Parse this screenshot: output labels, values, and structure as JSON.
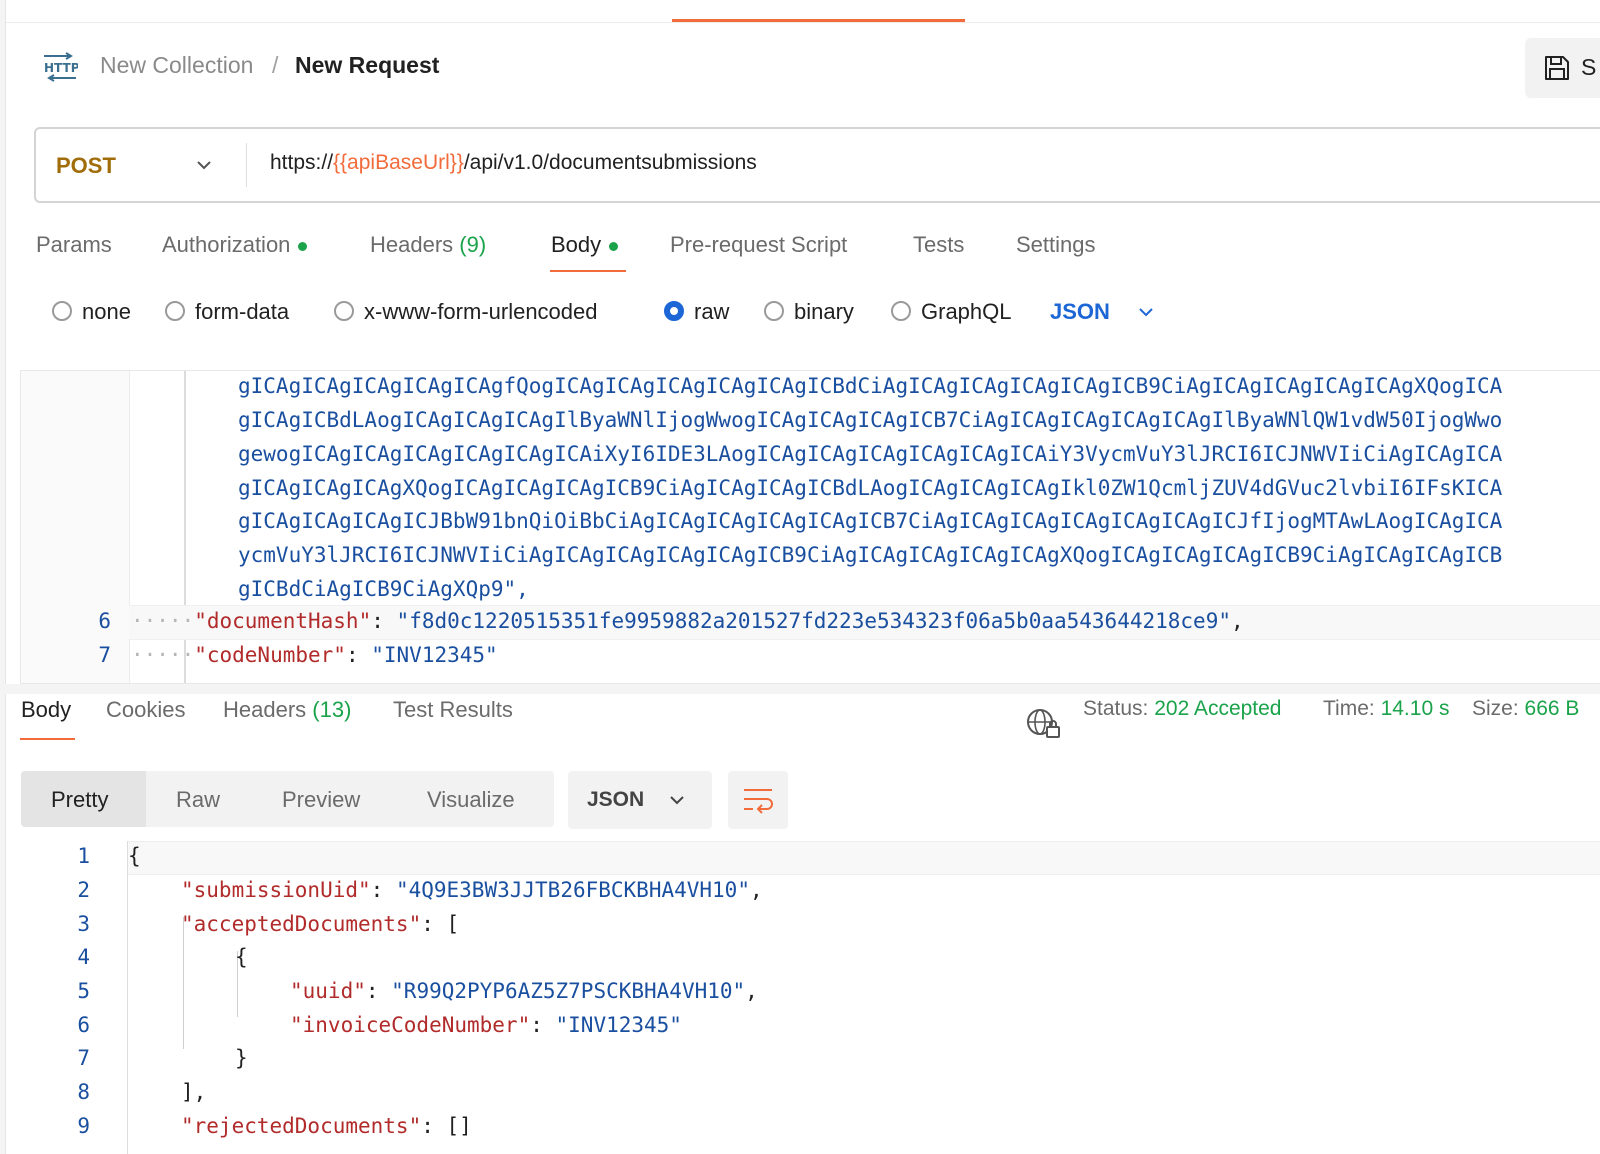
{
  "breadcrumb": {
    "collection": "New Collection",
    "separator": "/",
    "request": "New Request"
  },
  "save_button": {
    "label": "S"
  },
  "request": {
    "method": "POST",
    "url_prefix": "https://",
    "url_variable": "{{apiBaseUrl}}",
    "url_suffix": "/api/v1.0/documentsubmissions"
  },
  "request_tabs": [
    {
      "label": "Params"
    },
    {
      "label": "Authorization",
      "dot": true
    },
    {
      "label": "Headers",
      "count": "(9)"
    },
    {
      "label": "Body",
      "dot": true,
      "active": true
    },
    {
      "label": "Pre-request Script"
    },
    {
      "label": "Tests"
    },
    {
      "label": "Settings"
    }
  ],
  "body_types": [
    "none",
    "form-data",
    "x-www-form-urlencoded",
    "raw",
    "binary",
    "GraphQL"
  ],
  "body_type_selected": "raw",
  "body_format": "JSON",
  "request_editor": {
    "wrapped_lines": [
      "gICAgICAgICAgICAgICAgfQogICAgICAgICAgICAgICAgICBdCiAgICAgICAgICAgICAgICB9CiAgICAgICAgICAgICAgXQogICA",
      "gICAgICBdLAogICAgICAgICAgIlByaWNlIjogWwogICAgICAgICAgICB7CiAgICAgICAgICAgICAgIlByaWNlQW1vdW50IjogWwo",
      "gewogICAgICAgICAgICAgICAgICAiXyI6IDE3LAogICAgICAgICAgICAgICAgICAiY3VycmVuY3lJRCI6ICJNWVIiCiAgICAgICA",
      "gICAgICAgICAgXQogICAgICAgICAgICB9CiAgICAgICAgICBdLAogICAgICAgICAgIkl0ZW1QcmljZUV4dGVuc2lvbiI6IFsKICA",
      "gICAgICAgICAgICJBbW91bnQiOiBbCiAgICAgICAgICAgICAgICB7CiAgICAgICAgICAgICAgICAgICJfIjogMTAwLAogICAgICA",
      "ycmVuY3lJRCI6ICJNWVIiCiAgICAgICAgICAgICAgICB9CiAgICAgICAgICAgICAgXQogICAgICAgICAgICB9CiAgICAgICAgICB",
      "gICBdCiAgICB9CiAgXQp9\","
    ],
    "line6": {
      "number": "6",
      "dots": "·····",
      "key": "\"documentHash\"",
      "sep": ":",
      "value": "\"f8d0c1220515351fe9959882a201527fd223e534323f06a5b0aa543644218ce9\"",
      "comma": ","
    },
    "line7": {
      "number": "7",
      "dots": "·····",
      "key": "\"codeNumber\"",
      "sep": ":",
      "value": "\"INV12345\""
    }
  },
  "response_tabs": [
    {
      "label": "Body",
      "active": true
    },
    {
      "label": "Cookies"
    },
    {
      "label": "Headers",
      "count": "(13)"
    },
    {
      "label": "Test Results"
    }
  ],
  "response_status": {
    "status_label": "Status:",
    "status_value": "202 Accepted",
    "time_label": "Time:",
    "time_value": "14.10 s",
    "size_label": "Size:",
    "size_value": "666 B",
    "accent_color": "#1aa34a"
  },
  "view_modes": [
    "Pretty",
    "Raw",
    "Preview",
    "Visualize"
  ],
  "view_mode_selected": "Pretty",
  "response_format": "JSON",
  "response_lines": [
    {
      "n": "1",
      "text": "{"
    },
    {
      "n": "2",
      "key": "\"submissionUid\"",
      "value": "\"4Q9E3BW3JJTB26FBCKBHA4VH10\"",
      "tail": ","
    },
    {
      "n": "3",
      "key": "\"acceptedDocuments\"",
      "tail": "["
    },
    {
      "n": "4",
      "text": "{"
    },
    {
      "n": "5",
      "key": "\"uuid\"",
      "value": "\"R99Q2PYP6AZ5Z7PSCKBHA4VH10\"",
      "tail": ","
    },
    {
      "n": "6",
      "key": "\"invoiceCodeNumber\"",
      "value": "\"INV12345\""
    },
    {
      "n": "7",
      "text": "}"
    },
    {
      "n": "8",
      "text": "],"
    },
    {
      "n": "9",
      "key": "\"rejectedDocuments\"",
      "tail": "[]"
    }
  ],
  "colors": {
    "accent": "#f26b3a",
    "link_blue": "#1d66d6",
    "method": "#a06d0a",
    "json_key": "#b22b2b",
    "json_string": "#1a4fa0"
  }
}
